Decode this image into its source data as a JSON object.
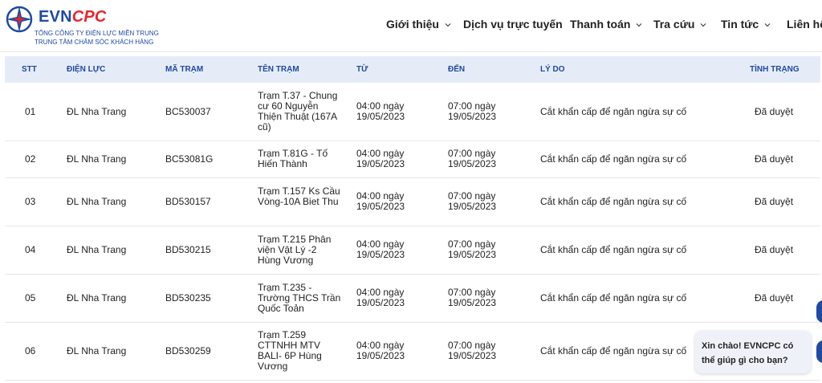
{
  "logo": {
    "brand_evn": "EVN",
    "brand_cpc": "CPC",
    "line1": "TỔNG CÔNG TY ĐIỆN LỰC MIỀN TRUNG",
    "line2": "TRUNG TÂM CHĂM SÓC KHÁCH HÀNG"
  },
  "nav": [
    {
      "label": "Giới thiệu",
      "dropdown": true
    },
    {
      "label": "Dịch vụ trực tuyến",
      "dropdown": false
    },
    {
      "label": "Thanh toán",
      "dropdown": true
    },
    {
      "label": "Tra cứu",
      "dropdown": true
    },
    {
      "label": "Tin tức",
      "dropdown": true
    },
    {
      "label": "Liên hệ",
      "dropdown": false
    }
  ],
  "table": {
    "headers": [
      "STT",
      "ĐIỆN LỰC",
      "MÃ TRẠM",
      "TÊN TRẠM",
      "TỪ",
      "ĐẾN",
      "LÝ DO",
      "TÌNH TRẠNG"
    ],
    "rows": [
      {
        "stt": "01",
        "dien_luc": "ĐL Nha Trang",
        "ma_tram": "BC530037",
        "ten_tram": "Trạm T.37 - Chung cư 60 Nguyễn Thiện Thuật (167A cũ)",
        "tu": "04:00 ngày 19/05/2023",
        "den": "07:00 ngày 19/05/2023",
        "ly_do": "Cắt khẩn cấp để ngăn ngừa sự cố",
        "tinh_trang": "Đã duyệt"
      },
      {
        "stt": "02",
        "dien_luc": "ĐL Nha Trang",
        "ma_tram": "BC53081G",
        "ten_tram": "Trạm T.81G - Tố Hiến Thành",
        "tu": "04:00 ngày 19/05/2023",
        "den": "07:00 ngày 19/05/2023",
        "ly_do": "Cắt khẩn cấp để ngăn ngừa sự cố",
        "tinh_trang": "Đã duyệt"
      },
      {
        "stt": "03",
        "dien_luc": "ĐL Nha Trang",
        "ma_tram": "BD530157",
        "ten_tram": "Trạm T.157 Ks Cầu Vòng-10A Biet Thu",
        "tu": "04:00 ngày 19/05/2023",
        "den": "07:00 ngày 19/05/2023",
        "ly_do": "Cắt khẩn cấp để ngăn ngừa sự cố",
        "tinh_trang": "Đã duyệt"
      },
      {
        "stt": "04",
        "dien_luc": "ĐL Nha Trang",
        "ma_tram": "BD530215",
        "ten_tram": "Trạm T.215 Phân viện Vật Lý -2 Hùng Vương",
        "tu": "04:00 ngày 19/05/2023",
        "den": "07:00 ngày 19/05/2023",
        "ly_do": "Cắt khẩn cấp để ngăn ngừa sự cố",
        "tinh_trang": "Đã duyệt"
      },
      {
        "stt": "05",
        "dien_luc": "ĐL Nha Trang",
        "ma_tram": "BD530235",
        "ten_tram": "Trạm T.235 - Trường THCS Trần Quốc Toản",
        "tu": "04:00 ngày 19/05/2023",
        "den": "07:00 ngày 19/05/2023",
        "ly_do": "Cắt khẩn cấp để ngăn ngừa sự cố",
        "tinh_trang": "Đã duyệt"
      },
      {
        "stt": "06",
        "dien_luc": "ĐL Nha Trang",
        "ma_tram": "BD530259",
        "ten_tram": "Trạm T.259 CTTNHH MTV BALI- 6P Hùng Vương",
        "tu": "04:00 ngày 19/05/2023",
        "den": "07:00 ngày 19/05/2023",
        "ly_do": "Cắt khẩn cấp để ngăn ngừa sự cố",
        "tinh_trang": ""
      }
    ]
  },
  "chat": {
    "message": "Xin chào! EVNCPC có thể giúp gì cho bạn?"
  },
  "colors": {
    "brand_blue": "#1e4aa3",
    "brand_red": "#e4262c",
    "header_row_bg": "#e6ecf7"
  }
}
